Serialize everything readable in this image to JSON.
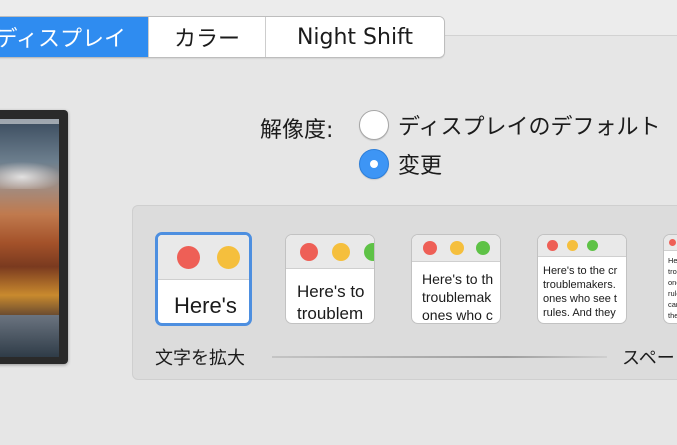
{
  "tabs": [
    {
      "label": "ディスプレイ",
      "selected": true
    },
    {
      "label": "カラー",
      "selected": false
    },
    {
      "label": "Night Shift",
      "selected": false
    }
  ],
  "resolution": {
    "label": "解像度:",
    "options": [
      {
        "label": "ディスプレイのデフォルト",
        "selected": false
      },
      {
        "label": "変更",
        "selected": true
      }
    ]
  },
  "scaling": {
    "previews": [
      {
        "lines": [
          "Here's"
        ],
        "selected": true
      },
      {
        "lines": [
          "Here's to",
          "troublem"
        ],
        "selected": false
      },
      {
        "lines": [
          "Here's to th",
          "troublemak",
          "ones who c"
        ],
        "selected": false
      },
      {
        "lines": [
          "Here's to the cr",
          "troublemakers.",
          "ones who see t",
          "rules. And they"
        ],
        "selected": false
      },
      {
        "lines": [
          "Here",
          "trou",
          "one",
          "rule",
          "can",
          "them",
          "Be"
        ],
        "selected": false
      }
    ],
    "label_larger": "文字を拡大",
    "label_space": "スペー"
  },
  "colors": {
    "accent": "#2f8cf0",
    "traffic_red": "#ee5f56",
    "traffic_yellow": "#f5bf3d",
    "traffic_green": "#5ec246"
  }
}
